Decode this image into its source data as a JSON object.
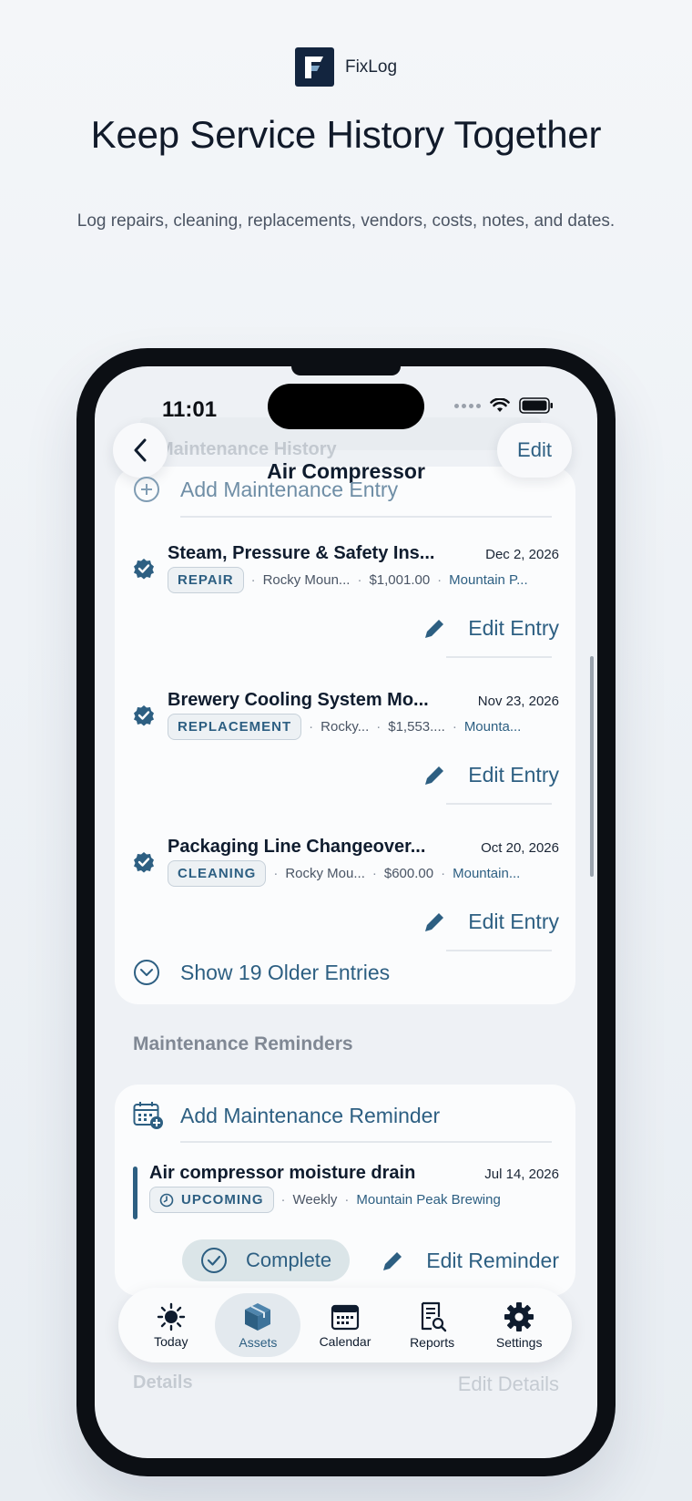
{
  "brand": {
    "name": "FixLog"
  },
  "hero": {
    "headline": "Keep Service History Together",
    "subline": "Log repairs, cleaning, replacements, vendors, costs, notes, and dates."
  },
  "status_bar": {
    "time": "11:01"
  },
  "nav": {
    "title": "Air Compressor",
    "edit_label": "Edit",
    "ghost_section": "Maintenance History"
  },
  "history": {
    "add_label": "Add Maintenance Entry",
    "entries": [
      {
        "title": "Steam, Pressure & Safety Ins...",
        "date": "Dec 2, 2026",
        "badge": "REPAIR",
        "vendor": "Rocky Moun...",
        "cost": "$1,001.00",
        "location": "Mountain P...",
        "edit_label": "Edit Entry"
      },
      {
        "title": "Brewery Cooling System Mo...",
        "date": "Nov 23, 2026",
        "badge": "REPLACEMENT",
        "vendor": "Rocky...",
        "cost": "$1,553....",
        "location": "Mounta...",
        "edit_label": "Edit Entry"
      },
      {
        "title": "Packaging Line Changeover...",
        "date": "Oct 20, 2026",
        "badge": "CLEANING",
        "vendor": "Rocky Mou...",
        "cost": "$600.00",
        "location": "Mountain...",
        "edit_label": "Edit Entry"
      }
    ],
    "show_older_label": "Show 19 Older Entries"
  },
  "reminders": {
    "section_title": "Maintenance Reminders",
    "add_label": "Add Maintenance Reminder",
    "item": {
      "title": "Air compressor moisture drain",
      "date": "Jul 14, 2026",
      "badge": "UPCOMING",
      "frequency": "Weekly",
      "location": "Mountain Peak Brewing",
      "complete_label": "Complete",
      "edit_label": "Edit Reminder"
    }
  },
  "details_ghost": {
    "title": "Details",
    "edit_label": "Edit Details"
  },
  "tabs": [
    {
      "label": "Today",
      "icon": "sun-icon"
    },
    {
      "label": "Assets",
      "icon": "cube-icon",
      "active": true
    },
    {
      "label": "Calendar",
      "icon": "calendar-icon"
    },
    {
      "label": "Reports",
      "icon": "report-icon"
    },
    {
      "label": "Settings",
      "icon": "gear-icon"
    }
  ],
  "colors": {
    "accent": "#2d5f82",
    "ink": "#0f1c2e",
    "background": "#eef1f5"
  }
}
